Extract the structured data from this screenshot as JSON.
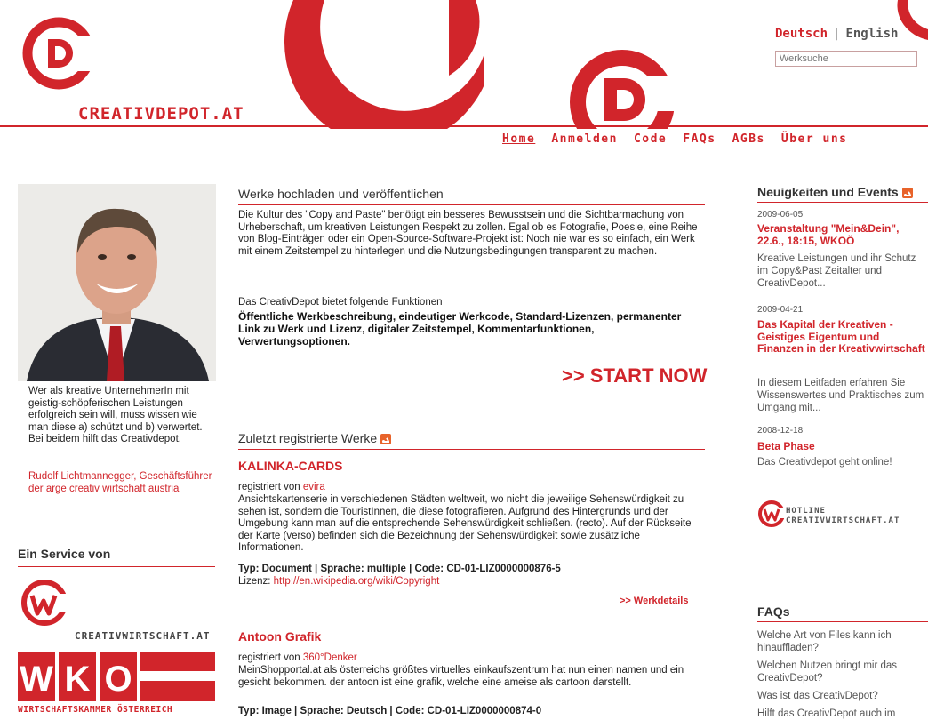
{
  "header": {
    "logo_text": "CREATIVDEPOT.AT",
    "lang_de": "Deutsch",
    "lang_sep": "|",
    "lang_en": "English",
    "search_placeholder": "Werksuche"
  },
  "nav": {
    "items": [
      "Home",
      "Anmelden",
      "Code",
      "FAQs",
      "AGBs",
      "Über uns"
    ],
    "active_index": 0
  },
  "left": {
    "intro_text": "Wer als kreative UnternehmerIn mit geistig-schöpferischen Leistungen erfolgreich sein will, muss wissen wie man diese a) schützt und b) verwertet. Bei beidem hilft das Creativdepot.",
    "author": "Rudolf Lichtmannegger, Geschäftsführer der arge creativ wirtschaft austria",
    "service_heading": "Ein Service von",
    "cw_logo_text": "CREATIVWIRTSCHAFT.AT",
    "wko_logo_text": "WKO",
    "wko_sub": "WIRTSCHAFTSKAMMER ÖSTERREICH"
  },
  "main": {
    "upload_heading": "Werke hochladen und veröffentlichen",
    "upload_text": "Die Kultur des \"Copy and Paste\" benötigt ein besseres Bewusstsein und die Sichtbarmachung von Urheberschaft, um kreativen Leistungen Respekt zu zollen. Egal ob es Fotografie, Poesie, eine Reihe von Blog-Einträgen oder ein Open-Source-Software-Projekt ist: Noch nie war es so einfach, ein Werk mit einem Zeitstempel zu hinterlegen und die Nutzungsbedingungen transparent zu machen.",
    "functions_label": "Das CreativDepot bietet folgende Funktionen",
    "functions_text": "Öffentliche Werkbeschreibung, eindeutiger Werkcode, Standard-Lizenzen, permanenter Link zu Werk und Lizenz, digitaler Zeitstempel, Kommentarfunktionen, Verwertungsoptionen.",
    "start_now": ">> START NOW",
    "recent_heading": "Zuletzt registrierte Werke",
    "works": [
      {
        "title": "KALINKA-CARDS",
        "registered_prefix": "registriert von ",
        "user": "evira",
        "description": "Ansichtskartenserie in verschiedenen Städten weltweit, wo nicht die jeweilige Sehenswürdigkeit zu sehen ist, sondern die TouristInnen, die diese fotografieren. Aufgrund des Hintergrunds und der Umgebung kann man auf die entsprechende Sehenswürdigkeit schließen. (recto). Auf der Rückseite der Karte (verso) befinden sich die Bezeichnung der Sehenswürdigkeit sowie zusätzliche Informationen.",
        "meta": "Typ: Document | Sprache: multiple | Code: CD-01-LIZ0000000876-5",
        "license_label": "Lizenz: ",
        "license_url": "http://en.wikipedia.org/wiki/Copyright",
        "details_link": ">> Werkdetails"
      },
      {
        "title": "Antoon Grafik",
        "registered_prefix": "registriert von ",
        "user": "360°Denker",
        "description": "MeinShopportal.at als österreichs größtes virtuelles einkaufszentrum hat nun einen namen und ein gesicht bekommen. der antoon ist eine grafik, welche eine ameise als cartoon darstellt.",
        "meta": "Typ: Image | Sprache: Deutsch | Code: CD-01-LIZ0000000874-0"
      }
    ]
  },
  "right": {
    "news_heading": "Neuigkeiten und Events",
    "news": [
      {
        "date": "2009-06-05",
        "title": "Veranstaltung \"Mein&Dein\", 22.6., 18:15, WKOÖ",
        "text": "Kreative Leistungen und ihr Schutz im Copy&Past Zeitalter und CreativDepot..."
      },
      {
        "date": "2009-04-21",
        "title": "Das Kapital der Kreativen - Geistiges Eigentum und Finanzen in der Kreativwirtschaft",
        "text": "In diesem Leitfaden erfahren Sie Wissenswertes und Praktisches zum Umgang mit..."
      },
      {
        "date": "2008-12-18",
        "title": "Beta Phase",
        "text": "Das Creativdepot geht online!"
      }
    ],
    "hotline_line1": "HOTLINE",
    "hotline_line2": "CREATIVWIRTSCHAFT.AT",
    "faq_heading": "FAQs",
    "faqs": [
      "Welche Art von Files kann ich hinauffladen?",
      "Welchen Nutzen bringt mir das CreativDepot?",
      "Was ist das CreativDepot?",
      "Hilft das CreativDepot auch im"
    ]
  },
  "colors": {
    "accent": "#d1252b",
    "text": "#222222",
    "muted": "#555555"
  }
}
